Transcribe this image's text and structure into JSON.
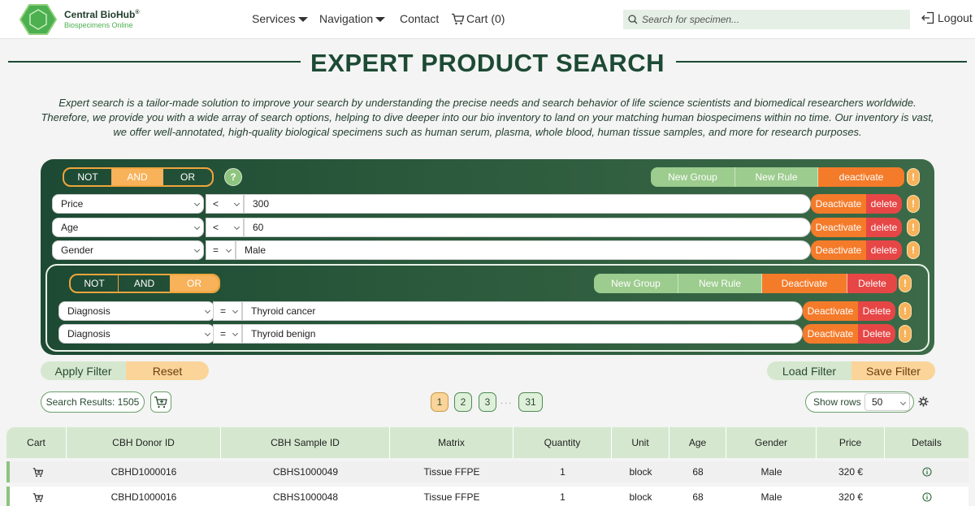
{
  "brand": {
    "name": "Central BioHub",
    "reg": "®",
    "tagline": "Biospecimens Online"
  },
  "nav": {
    "services": "Services",
    "navigation": "Navigation",
    "contact": "Contact",
    "cart": "Cart (0)",
    "logout": "Logout"
  },
  "search": {
    "placeholder": "Search for specimen..."
  },
  "page": {
    "title": "EXPERT PRODUCT SEARCH",
    "intro": [
      "Expert search is a tailor-made solution to improve your search by understanding the precise needs and search behavior of life science scientists and biomedical researchers worldwide.",
      "Therefore, we provide you with a wide array of search options, helping to dive deeper into our bio inventory to land on your matching human biospecimens within no time. Our inventory is vast,",
      "we offer well-annotated, high-quality biological specimens such as human serum, plasma, whole blood, human tissue samples, and more for research purposes."
    ]
  },
  "builder": {
    "main": {
      "logic": {
        "not": "NOT",
        "and": "AND",
        "or": "OR"
      },
      "help": "?",
      "actions": {
        "new_group": "New Group",
        "new_rule": "New Rule",
        "deactivate": "deactivate"
      },
      "alert": "!",
      "rules": [
        {
          "field": "Price",
          "op": "<",
          "value": "300",
          "deactivate": "Deactivate",
          "delete": "delete",
          "alert": "!"
        },
        {
          "field": "Age",
          "op": "<",
          "value": "60",
          "deactivate": "Deactivate",
          "delete": "delete",
          "alert": "!"
        },
        {
          "field": "Gender",
          "op": "=",
          "value": "Male",
          "deactivate": "Deactivate",
          "delete": "delete",
          "alert": "!"
        }
      ]
    },
    "group": {
      "logic": {
        "not": "NOT",
        "and": "AND",
        "or": "OR"
      },
      "actions": {
        "new_group": "New Group",
        "new_rule": "New Rule",
        "deactivate": "Deactivate",
        "delete": "Delete"
      },
      "alert": "!",
      "rules": [
        {
          "field": "Diagnosis",
          "op": "=",
          "value": "Thyroid cancer",
          "deactivate": "Deactivate",
          "delete": "Delete",
          "alert": "!"
        },
        {
          "field": "Diagnosis",
          "op": "=",
          "value": "Thyroid benign",
          "deactivate": "Deactivate",
          "delete": "Delete",
          "alert": "!"
        }
      ]
    }
  },
  "filter": {
    "apply": "Apply Filter",
    "reset": "Reset",
    "load": "Load Filter",
    "save": "Save Filter"
  },
  "results": {
    "label": "Search Results: 1505"
  },
  "pagination": {
    "pages": [
      "1",
      "2",
      "3",
      "31"
    ],
    "ellipsis": "...",
    "current": "1"
  },
  "rows": {
    "label": "Show rows",
    "value": "50"
  },
  "table": {
    "headers": [
      "Cart",
      "CBH Donor ID",
      "CBH Sample ID",
      "Matrix",
      "Quantity",
      "Unit",
      "Age",
      "Gender",
      "Price",
      "Details"
    ],
    "rows": [
      {
        "donor": "CBHD1000016",
        "sample": "CBHS1000049",
        "matrix": "Tissue FFPE",
        "quantity": "1",
        "unit": "block",
        "age": "68",
        "gender": "Male",
        "price": "320 €"
      },
      {
        "donor": "CBHD1000016",
        "sample": "CBHS1000048",
        "matrix": "Tissue FFPE",
        "quantity": "1",
        "unit": "block",
        "age": "68",
        "gender": "Male",
        "price": "320 €"
      }
    ]
  },
  "colors": {
    "brand_green": "#1d4a34",
    "accent_orange": "#f7b25a",
    "action_red": "#e74646",
    "light_green": "#d5e8cf"
  },
  "icons": {
    "logo": "hexagon-logo-icon",
    "cart": "cart-icon",
    "search": "search-icon",
    "logout": "logout-icon",
    "settings": "gear-icon",
    "details": "info-icon",
    "add_to_cart": "cart-plus-icon"
  }
}
